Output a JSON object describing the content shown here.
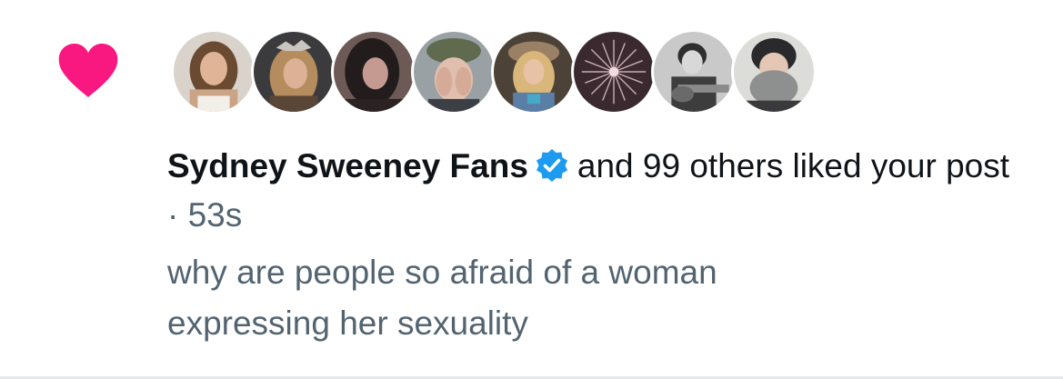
{
  "notification": {
    "type_icon": "heart-icon",
    "accent_color": "#f91880",
    "verified_color": "#1d9bf0",
    "avatars": [
      {
        "name": "avatar-1"
      },
      {
        "name": "avatar-2"
      },
      {
        "name": "avatar-3"
      },
      {
        "name": "avatar-4"
      },
      {
        "name": "avatar-5"
      },
      {
        "name": "avatar-6"
      },
      {
        "name": "avatar-7"
      },
      {
        "name": "avatar-8"
      }
    ],
    "liker_name": "Sydney Sweeney Fans",
    "liker_verified_icon": "verified-badge-icon",
    "action_text": "and 99 others liked your post",
    "separator": "·",
    "timestamp": "53s",
    "post_snippet": "why are people so afraid of a woman expressing her sexuality"
  }
}
